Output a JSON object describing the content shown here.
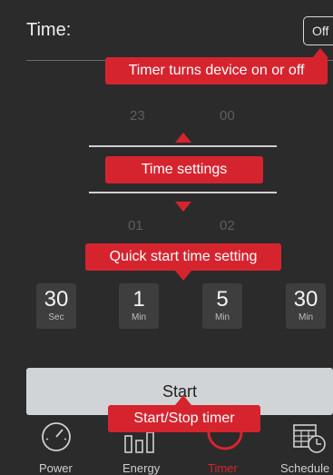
{
  "header": {
    "time_label": "Time:",
    "off_button": "Off"
  },
  "callouts": {
    "timer_power": "Timer turns device on or off",
    "time_settings": "Time settings",
    "quick_start": "Quick start time setting",
    "start_stop": "Start/Stop timer"
  },
  "picker": {
    "above": {
      "hours": "23",
      "minutes": "00"
    },
    "below": {
      "hours": "01",
      "minutes": "02"
    }
  },
  "quick_tiles": [
    {
      "value": "30",
      "unit": "Sec"
    },
    {
      "value": "1",
      "unit": "Min"
    },
    {
      "value": "5",
      "unit": "Min"
    },
    {
      "value": "30",
      "unit": "Min"
    }
  ],
  "start_button": "Start",
  "nav": [
    {
      "label": "Power",
      "icon": "gauge-icon"
    },
    {
      "label": "Energy",
      "icon": "bar-chart-icon"
    },
    {
      "label": "Timer",
      "icon": "timer-icon",
      "active": true
    },
    {
      "label": "Schedule",
      "icon": "calendar-clock-icon"
    }
  ],
  "colors": {
    "accent": "#d6242f",
    "background": "#2b2b2b",
    "tile": "#3e3e3e",
    "start_button": "#d1d4d6"
  }
}
